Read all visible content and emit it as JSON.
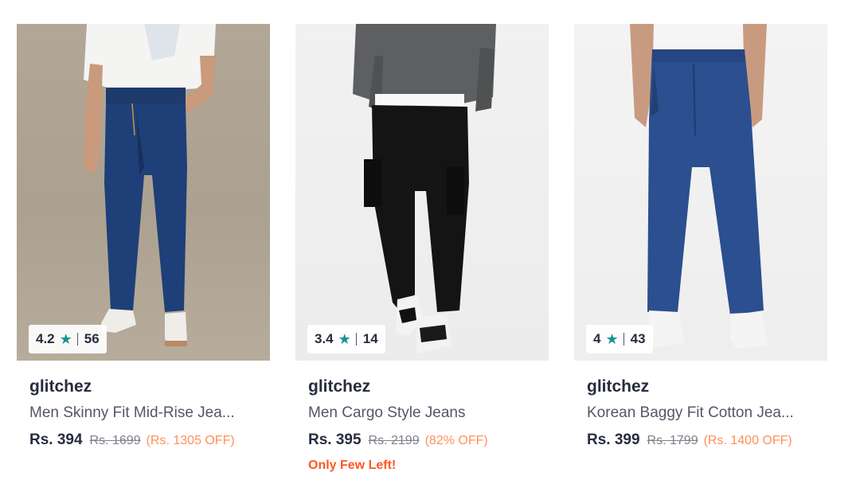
{
  "products": [
    {
      "rating": "4.2",
      "rating_count": "56",
      "brand": "glitchez",
      "name": "Men Skinny Fit Mid-Rise Jea...",
      "price": "Rs. 394",
      "mrp": "Rs. 1699",
      "discount": "(Rs. 1305 OFF)"
    },
    {
      "rating": "3.4",
      "rating_count": "14",
      "brand": "glitchez",
      "name": "Men Cargo Style Jeans",
      "price": "Rs. 395",
      "mrp": "Rs. 2199",
      "discount": "(82% OFF)",
      "stock_note": "Only Few Left!"
    },
    {
      "rating": "4",
      "rating_count": "43",
      "brand": "glitchez",
      "name": "Korean Baggy Fit Cotton Jea...",
      "price": "Rs. 399",
      "mrp": "Rs. 1799",
      "discount": "(Rs. 1400 OFF)"
    }
  ],
  "icons": {
    "rating_star": "star-icon"
  },
  "colors": {
    "star": "#14958f",
    "discount": "#ff905a",
    "stock_note": "#ff5722",
    "text_primary": "#282c3f",
    "text_secondary": "#535766"
  }
}
